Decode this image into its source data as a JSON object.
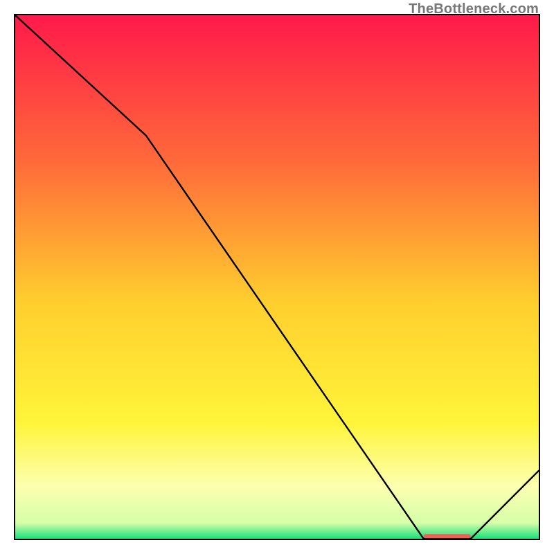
{
  "watermark": "TheBottleneck.com",
  "chart_data": {
    "type": "line",
    "title": "",
    "xlabel": "",
    "ylabel": "",
    "xlim": [
      0,
      100
    ],
    "ylim": [
      0,
      100
    ],
    "series": [
      {
        "name": "bottleneck-curve",
        "x": [
          0,
          25,
          78,
          87,
          100
        ],
        "values": [
          100,
          77,
          0,
          0,
          13
        ]
      }
    ],
    "optimal_marker": {
      "x_start": 78,
      "x_end": 87,
      "y": 0.5,
      "color": "#ef6055"
    },
    "gradient_stops": [
      {
        "pos": 0,
        "color": "#ff1a4a"
      },
      {
        "pos": 28,
        "color": "#ff6a3a"
      },
      {
        "pos": 55,
        "color": "#ffcf2e"
      },
      {
        "pos": 78,
        "color": "#fff53a"
      },
      {
        "pos": 90,
        "color": "#fcffb0"
      },
      {
        "pos": 97,
        "color": "#d6ffa8"
      },
      {
        "pos": 100,
        "color": "#16e07a"
      }
    ]
  }
}
